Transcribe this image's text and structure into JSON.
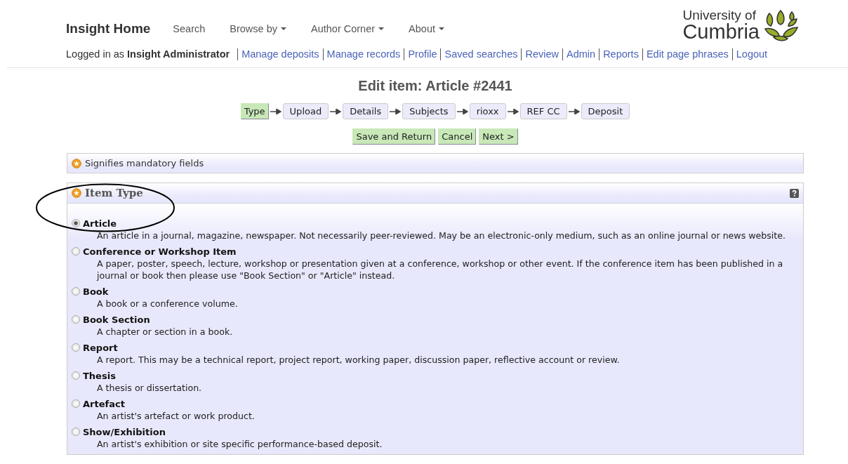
{
  "nav": {
    "brand": "Insight Home",
    "items": [
      {
        "label": "Search",
        "dropdown": false
      },
      {
        "label": "Browse by",
        "dropdown": true
      },
      {
        "label": "Author Corner",
        "dropdown": true
      },
      {
        "label": "About",
        "dropdown": true
      }
    ]
  },
  "logo": {
    "line_1": "University of",
    "line_2": "Cumbria"
  },
  "user_bar": {
    "prefix": "Logged in as",
    "user": "Insight Administrator",
    "links": [
      "Manage deposits",
      "Manage records",
      "Profile",
      "Saved searches",
      "Review",
      "Admin",
      "Reports",
      "Edit page phrases",
      "Logout"
    ]
  },
  "page_title": "Edit item: Article #2441",
  "steps": [
    {
      "label": "Type",
      "selected": true
    },
    {
      "label": "Upload",
      "selected": false
    },
    {
      "label": "Details",
      "selected": false
    },
    {
      "label": "Subjects",
      "selected": false
    },
    {
      "label": "rioxx",
      "selected": false
    },
    {
      "label": "REF CC",
      "selected": false
    },
    {
      "label": "Deposit",
      "selected": false
    }
  ],
  "actions": [
    "Save and Return",
    "Cancel",
    "Next >"
  ],
  "mandatory_note": "Signifies mandatory fields",
  "item_type": {
    "title": "Item Type",
    "options": [
      {
        "label": "Article",
        "description": "An article in a journal, magazine, newspaper. Not necessarily peer-reviewed. May be an electronic-only medium, such as an online journal or news website.",
        "selected": true
      },
      {
        "label": "Conference or Workshop Item",
        "description": "A paper, poster, speech, lecture, workshop or presentation given at a conference, workshop or other event. If the conference item has been published in a journal or book then please use \"Book Section\" or \"Article\" instead.",
        "selected": false
      },
      {
        "label": "Book",
        "description": "A book or a conference volume.",
        "selected": false
      },
      {
        "label": "Book Section",
        "description": "A chapter or section in a book.",
        "selected": false
      },
      {
        "label": "Report",
        "description": "A report. This may be a technical report, project report, working paper, discussion paper, reflective account or review.",
        "selected": false
      },
      {
        "label": "Thesis",
        "description": "A thesis or dissertation.",
        "selected": false
      },
      {
        "label": "Artefact",
        "description": "An artist's artefact or work product.",
        "selected": false
      },
      {
        "label": "Show/Exhibition",
        "description": "An artist's exhibition or site specific performance-based deposit.",
        "selected": false
      }
    ]
  }
}
